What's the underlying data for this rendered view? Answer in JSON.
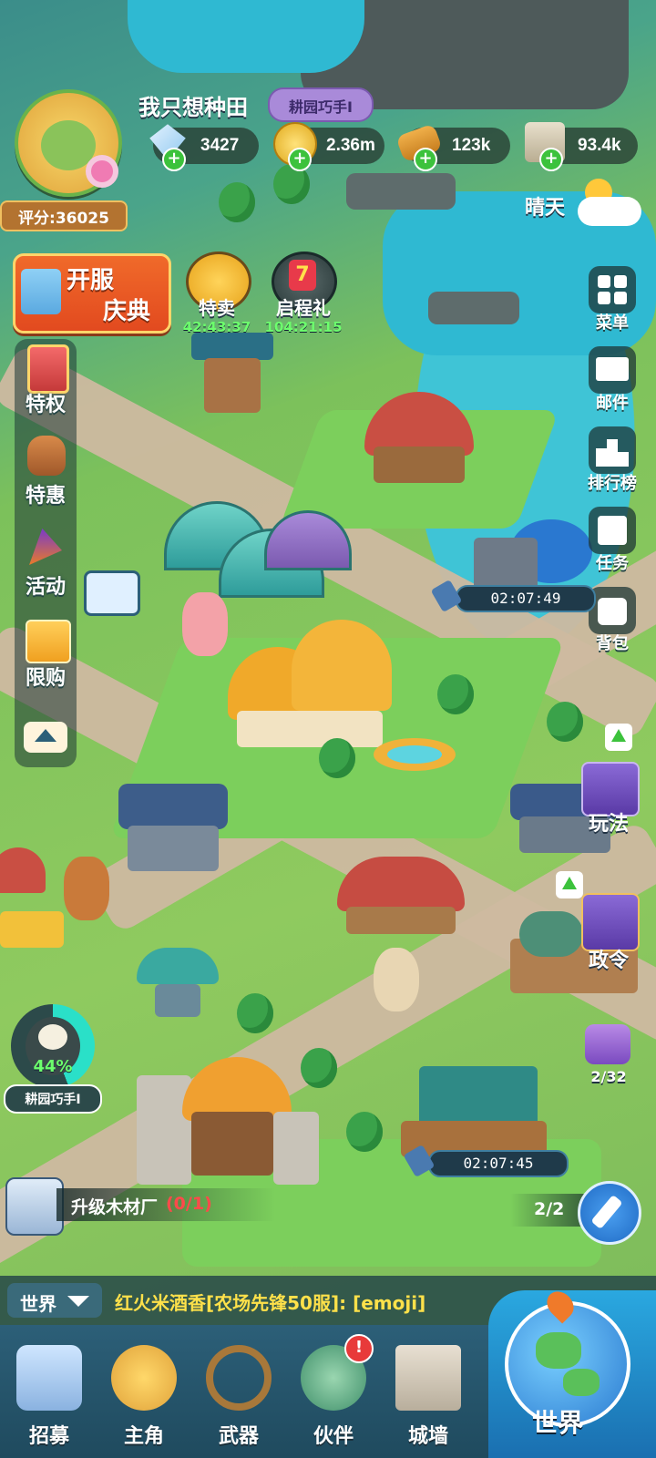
{
  "player": {
    "name": "我只想种田",
    "title_badge": "耕园巧手Ⅰ",
    "score_label": "评分:36025"
  },
  "resources": [
    {
      "name": "gem",
      "value": "3427"
    },
    {
      "name": "gold",
      "value": "2.36m"
    },
    {
      "name": "wood",
      "value": "123k"
    },
    {
      "name": "stone",
      "value": "93.4k"
    }
  ],
  "weather": {
    "label": "晴天"
  },
  "events": {
    "festival": {
      "line1": "开服",
      "line2": "庆典"
    },
    "special_sale": {
      "label": "特卖",
      "timer": "42:43:37"
    },
    "start_gift": {
      "label": "启程礼",
      "timer": "104:21:15",
      "badge": "7"
    }
  },
  "left_menu": [
    {
      "label": "特权"
    },
    {
      "label": "特惠"
    },
    {
      "label": "活动"
    },
    {
      "label": "限购"
    }
  ],
  "right_menu": [
    {
      "label": "菜单"
    },
    {
      "label": "邮件"
    },
    {
      "label": "排行榜"
    },
    {
      "label": "任务"
    },
    {
      "label": "背包"
    }
  ],
  "building_timers": [
    "02:07:49",
    "02:07:45"
  ],
  "side_features": {
    "gameplay": "玩法",
    "decree": "政令",
    "watering_can_count": "2/32"
  },
  "progress": {
    "percent_text": "44%",
    "percent": 0.44,
    "label": "耕园巧手Ⅰ"
  },
  "quest": {
    "text": "升级木材厂",
    "progress": "(0/1)"
  },
  "build_queue": {
    "count": "2/2"
  },
  "chat": {
    "channel": "世界",
    "message": "红火米酒香[农场先锋50服]: [emoji]"
  },
  "bottom_nav": [
    {
      "label": "招募",
      "icon": "harp-icon"
    },
    {
      "label": "主角",
      "icon": "hero-icon"
    },
    {
      "label": "武器",
      "icon": "bow-icon"
    },
    {
      "label": "伙伴",
      "icon": "partner-icon",
      "badge": "!"
    },
    {
      "label": "城墙",
      "icon": "wall-icon"
    }
  ],
  "world_button": {
    "label": "世界"
  },
  "colors": {
    "accent_green": "#3cc23c",
    "timer_blue": "#2aa8e0",
    "chat_highlight": "#ffe14a",
    "purple_badge": "#a98ad9"
  }
}
